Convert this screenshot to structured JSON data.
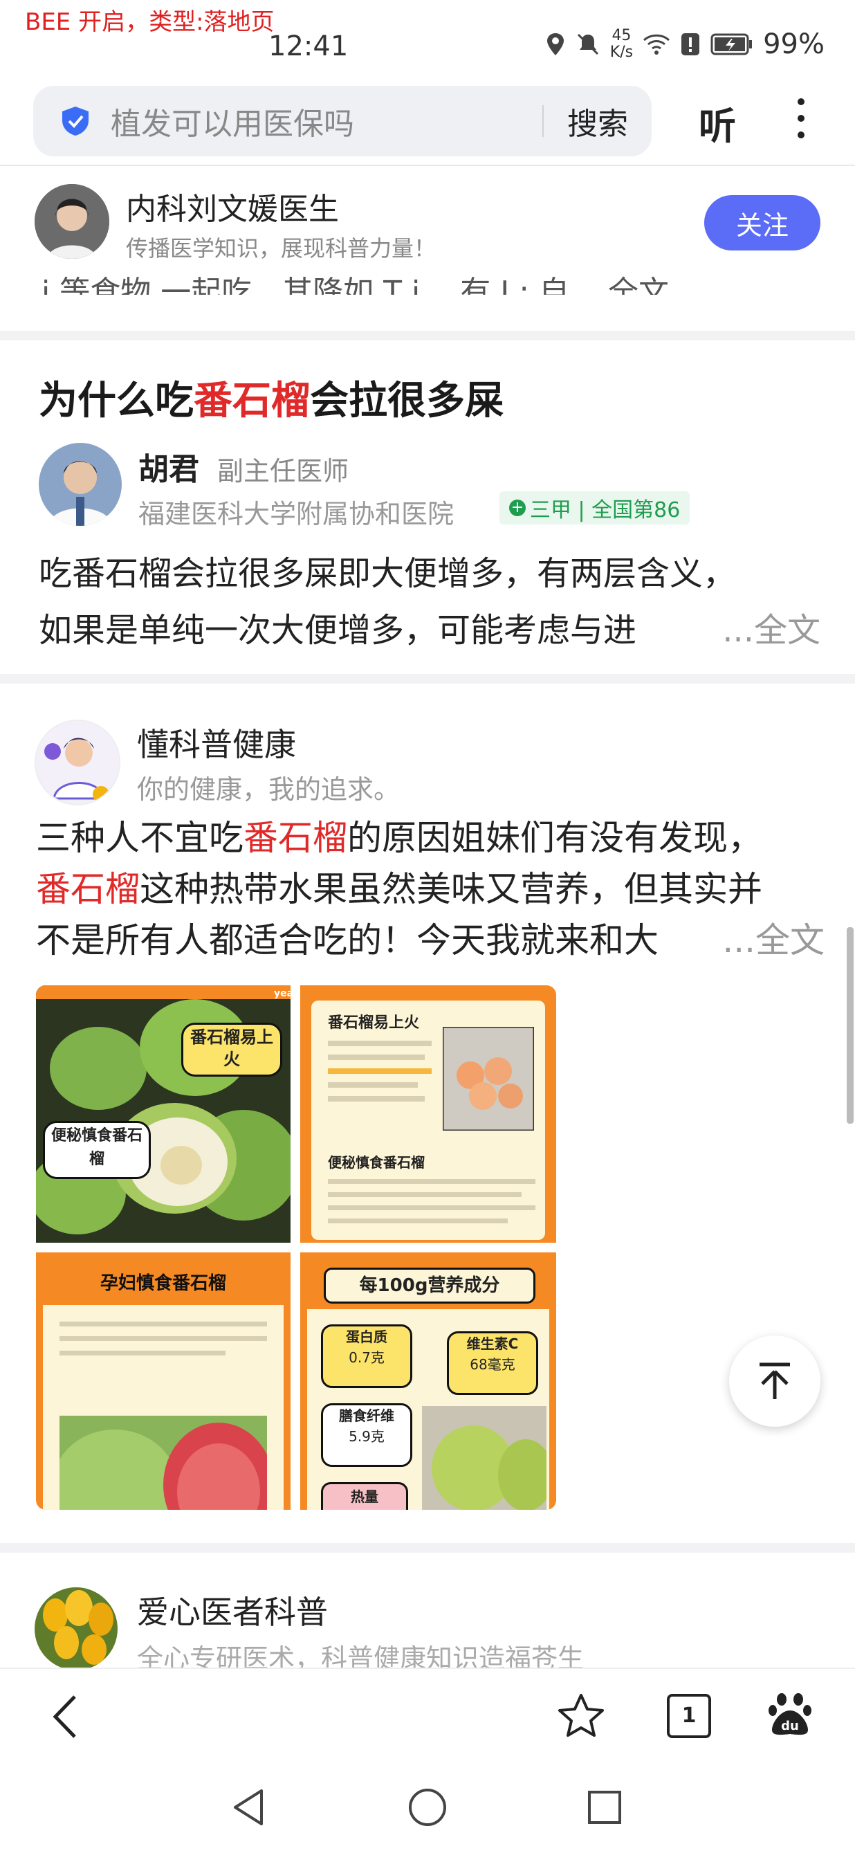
{
  "debug_label": "BEE 开启，类型:落地页",
  "status_bar": {
    "time": "12:41",
    "net_speed_value": "45",
    "net_speed_unit": "K/s",
    "battery": "99%"
  },
  "search": {
    "query": "植发可以用医保吗",
    "button": "搜索",
    "listen": "听"
  },
  "card1": {
    "author": "内科刘文媛医生",
    "subtitle": "传播医学知识，展现科普力量！",
    "follow": "关注",
    "cut_text": "i 等食物 一起吃，其降如 T  i、 有 J : 自  ...全文"
  },
  "card2": {
    "title_pre": "为什么吃",
    "title_hl": "番石榴",
    "title_post": "会拉很多屎",
    "author": "胡君",
    "rank": "副主任医师",
    "hospital": "福建医科大学附属协和医院",
    "badge": "三甲 | 全国第86",
    "line1": "吃番石榴会拉很多屎即大便增多，有两层含义，",
    "line2": "如果是单纯一次大便增多，可能考虑与进",
    "more": "...全文"
  },
  "card3": {
    "author": "懂科普健康",
    "subtitle": "你的健康，我的追求。",
    "p1": "三种人不宜吃",
    "p1_hl": "番石榴",
    "p1_post": "的原因姐妹们有没有发现，",
    "p2_hl": "番石榴",
    "p2_post": "这种热带水果虽然美味又营养，但其实并",
    "p3": "不是所有人都适合吃的！今天我就来和大",
    "more": "...全文",
    "images": {
      "t1_label": "番石榴易上火",
      "t1_label2": "便秘慎食番石榴",
      "t2_title": "番石榴易上火",
      "t2_sub": "便秘慎食番石榴",
      "t3_title": "孕妇慎食番石榴",
      "t4_title": "每100g营养成分",
      "t4_protein": "蛋白质",
      "t4_protein_val": "0.7克",
      "t4_vc": "维生素C",
      "t4_vc_val": "68毫克",
      "t4_fiber": "膳食纤维",
      "t4_fiber_val": "5.9克",
      "t4_heat": "热量",
      "yeah": "yeah!"
    }
  },
  "card4": {
    "author": "爱心医者科普",
    "subtitle": "全心专研医术，科普健康知识造福苍生"
  },
  "bottom_nav": {
    "tab_count": "1"
  }
}
